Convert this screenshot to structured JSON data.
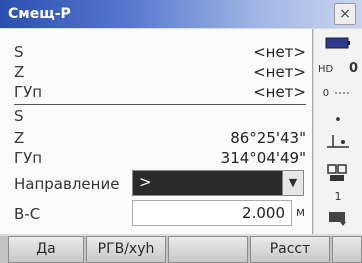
{
  "window": {
    "title": "Смещ-Р",
    "close_label": "×"
  },
  "fields_top": [
    {
      "label": "S",
      "value": "<нет>"
    },
    {
      "label": "Z",
      "value": "<нет>"
    },
    {
      "label": "ГУп",
      "value": "<нет>"
    }
  ],
  "fields_bottom": [
    {
      "label": "S",
      "value": ""
    },
    {
      "label": "Z",
      "value": "86°25'43\""
    },
    {
      "label": "ГУп",
      "value": "314°04'49\""
    }
  ],
  "direction": {
    "label": "Направление",
    "value": ">"
  },
  "bc": {
    "label": "В-С",
    "value": "2.000",
    "unit": "м"
  },
  "sidebar": {
    "battery_icon": "battery-icon",
    "hd_text": "HD",
    "zero_text": "0",
    "prism_text": "0",
    "dot_text": "•",
    "mode_text": "1"
  },
  "softkeys": [
    {
      "label": "Да"
    },
    {
      "label": "РГВ/хуh"
    },
    {
      "label": ""
    },
    {
      "label": "Расст"
    },
    {
      "label": ""
    }
  ]
}
